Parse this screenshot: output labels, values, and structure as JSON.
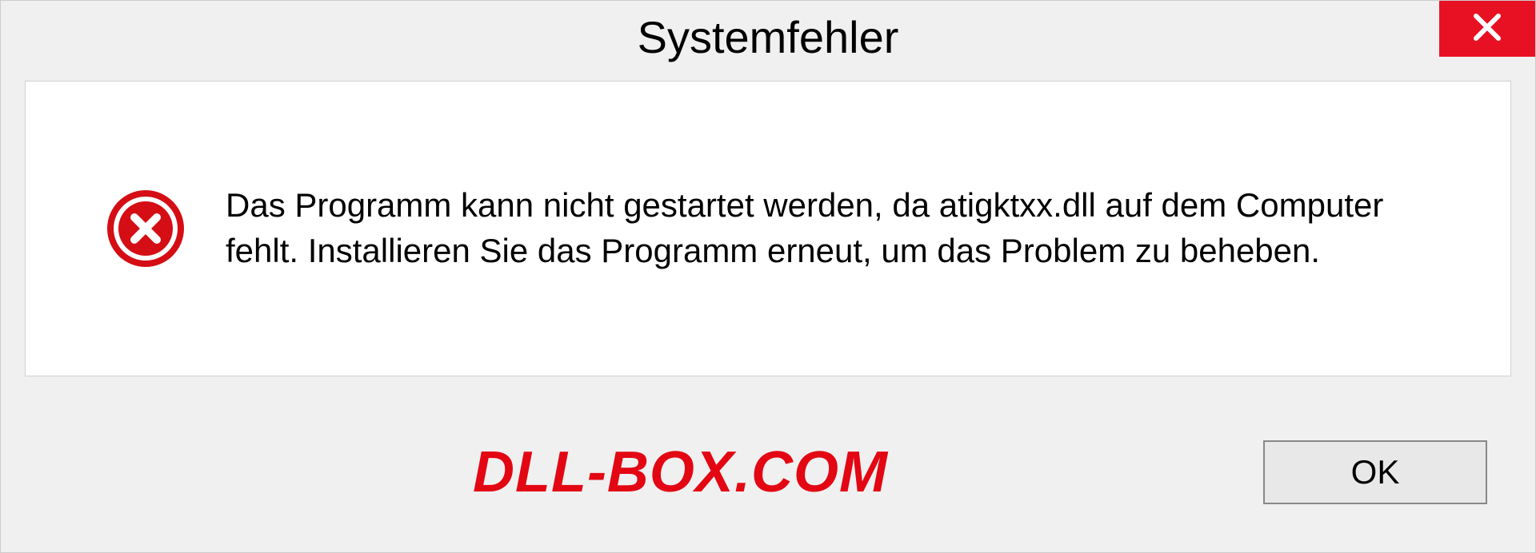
{
  "dialog": {
    "title": "Systemfehler",
    "message": "Das Programm kann nicht gestartet werden, da atigktxx.dll auf dem Computer fehlt. Installieren Sie das Programm erneut, um das Problem zu beheben.",
    "ok_label": "OK"
  },
  "watermark": "DLL-BOX.COM"
}
